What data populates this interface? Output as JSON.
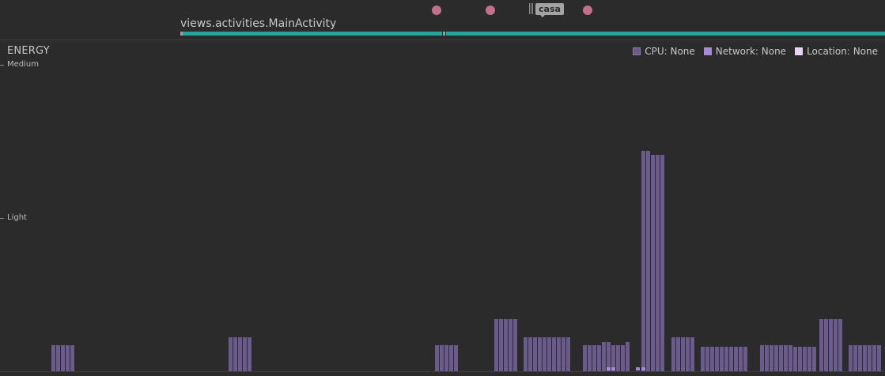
{
  "events": {
    "dot_color": "#c2708f",
    "tag_label": "casa"
  },
  "activity": {
    "label": "views.activities.MainActivity",
    "bar_color": "#26a69a"
  },
  "energy": {
    "title": "ENERGY",
    "legend": [
      {
        "label": "CPU: None",
        "color": "#6b5a8c"
      },
      {
        "label": "Network: None",
        "color": "#a88ad8"
      },
      {
        "label": "Location: None",
        "color": "#e6d6f5"
      }
    ],
    "axis": {
      "medium_label": "Medium",
      "light_label": "Light"
    }
  },
  "chart_data": {
    "type": "bar",
    "ylim_levels": [
      "None",
      "Light",
      "Medium"
    ],
    "series": [
      {
        "name": "CPU",
        "values": [
          0.17,
          0.17,
          0.17,
          0.17,
          0.17,
          0.0,
          0.22,
          0.22,
          0.22,
          0.22,
          0.22,
          0.0,
          0.17,
          0.17,
          0.17,
          0.17,
          0.17,
          0.34,
          0.34,
          0.34,
          0.34,
          0.34,
          0.22,
          0.22,
          0.22,
          0.22,
          0.22,
          0.22,
          0.22,
          0.22,
          0.22,
          0.22,
          0.17,
          0.17,
          0.17,
          0.17,
          0.19,
          0.19,
          0.17,
          0.17,
          0.17,
          0.19,
          1.44,
          1.44,
          1.41,
          1.41,
          1.41,
          0.22,
          0.22,
          0.22,
          0.22,
          0.22,
          0.16,
          0.16,
          0.16,
          0.16,
          0.16,
          0.16,
          0.16,
          0.16,
          0.16,
          0.16,
          0.17,
          0.17,
          0.17,
          0.17,
          0.17,
          0.17,
          0.17,
          0.16,
          0.16,
          0.16,
          0.16,
          0.16,
          0.34,
          0.34,
          0.34,
          0.34,
          0.34,
          0.17,
          0.17,
          0.17,
          0.17,
          0.17,
          0.17,
          0.17
        ]
      },
      {
        "name": "Network",
        "values": [
          0.02,
          0.02,
          0.02,
          0.02
        ]
      }
    ]
  }
}
